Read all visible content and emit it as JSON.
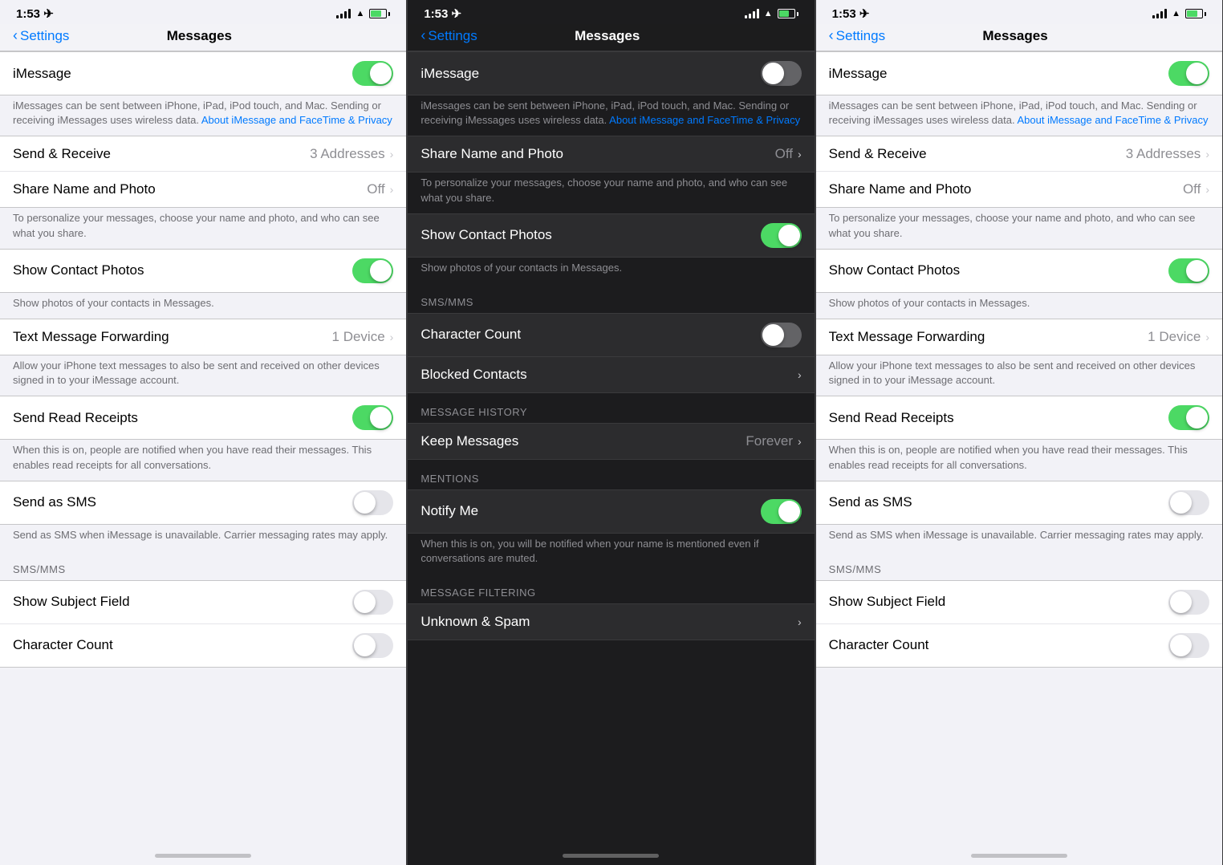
{
  "screens": [
    {
      "id": "screen-1",
      "theme": "light",
      "status": {
        "time": "1:53",
        "signal": true,
        "wifi": true,
        "battery_charge": true
      },
      "nav": {
        "back_label": "Settings",
        "title": "Messages"
      },
      "imessage": {
        "label": "iMessage",
        "state": "on"
      },
      "description1": "iMessages can be sent between iPhone, iPad, iPod touch, and Mac. Sending or receiving iMessages uses wireless data.",
      "link1": "About iMessage and FaceTime & Privacy",
      "rows": [
        {
          "label": "Send & Receive",
          "value": "3 Addresses",
          "has_chevron": true,
          "toggle": null
        },
        {
          "label": "Share Name and Photo",
          "value": "Off",
          "has_chevron": true,
          "toggle": null
        },
        {
          "description": "To personalize your messages, choose your name and photo, and who can see what you share."
        },
        {
          "label": "Show Contact Photos",
          "value": null,
          "has_chevron": false,
          "toggle": "on"
        },
        {
          "description": "Show photos of your contacts in Messages."
        },
        {
          "label": "Text Message Forwarding",
          "value": "1 Device",
          "has_chevron": true,
          "toggle": null
        },
        {
          "description": "Allow your iPhone text messages to also be sent and received on other devices signed in to your iMessage account."
        },
        {
          "label": "Send Read Receipts",
          "value": null,
          "has_chevron": false,
          "toggle": "on"
        },
        {
          "description": "When this is on, people are notified when you have read their messages. This enables read receipts for all conversations."
        },
        {
          "label": "Send as SMS",
          "value": null,
          "has_chevron": false,
          "toggle": "off"
        },
        {
          "description": "Send as SMS when iMessage is unavailable. Carrier messaging rates may apply."
        }
      ],
      "sms_section": "SMS/MMS",
      "sms_rows": [
        {
          "label": "Show Subject Field",
          "toggle": "off"
        },
        {
          "label": "Character Count",
          "toggle": "off"
        }
      ]
    },
    {
      "id": "screen-2",
      "theme": "dark",
      "status": {
        "time": "1:53",
        "signal": true,
        "wifi": true,
        "battery_charge": true
      },
      "nav": {
        "back_label": "Settings",
        "title": "Messages"
      },
      "imessage": {
        "label": "iMessage",
        "state": "off"
      },
      "description1": "iMessages can be sent between iPhone, iPad, iPod touch, and Mac. Sending or receiving iMessages uses wireless data.",
      "link1": "About iMessage and FaceTime & Privacy",
      "rows": [
        {
          "label": "Share Name and Photo",
          "value": "Off",
          "has_chevron": true,
          "toggle": null
        },
        {
          "description": "To personalize your messages, choose your name and photo, and who can see what you share."
        },
        {
          "label": "Show Contact Photos",
          "value": null,
          "has_chevron": false,
          "toggle": "on"
        },
        {
          "description": "Show photos of your contacts in Messages."
        }
      ],
      "sms_section": "SMS/MMS",
      "sms_rows": [
        {
          "label": "Character Count",
          "toggle": "off"
        },
        {
          "label": "Blocked Contacts",
          "value": null,
          "has_chevron": true
        }
      ],
      "message_history_section": "MESSAGE HISTORY",
      "message_history_rows": [
        {
          "label": "Keep Messages",
          "value": "Forever",
          "has_chevron": true
        }
      ],
      "mentions_section": "MENTIONS",
      "mentions_rows": [
        {
          "label": "Notify Me",
          "toggle": "on"
        },
        {
          "description": "When this is on, you will be notified when your name is mentioned even if conversations are muted."
        }
      ],
      "filtering_section": "MESSAGE FILTERING",
      "filtering_rows": [
        {
          "label": "Unknown & Spam",
          "has_chevron": true
        }
      ]
    },
    {
      "id": "screen-3",
      "theme": "light",
      "status": {
        "time": "1:53",
        "signal": true,
        "wifi": true,
        "battery_charge": true
      },
      "nav": {
        "back_label": "Settings",
        "title": "Messages"
      },
      "imessage": {
        "label": "iMessage",
        "state": "on"
      },
      "description1": "iMessages can be sent between iPhone, iPad, iPod touch, and Mac. Sending or receiving iMessages uses wireless data.",
      "link1": "About iMessage and FaceTime & Privacy",
      "rows": [
        {
          "label": "Send & Receive",
          "value": "3 Addresses",
          "has_chevron": true,
          "toggle": null
        },
        {
          "label": "Share Name and Photo",
          "value": "Off",
          "has_chevron": true,
          "toggle": null
        },
        {
          "description": "To personalize your messages, choose your name and photo, and who can see what you share."
        },
        {
          "label": "Show Contact Photos",
          "value": null,
          "has_chevron": false,
          "toggle": "on"
        },
        {
          "description": "Show photos of your contacts in Messages."
        },
        {
          "label": "Text Message Forwarding",
          "value": "1 Device",
          "has_chevron": true,
          "toggle": null
        },
        {
          "description": "Allow your iPhone text messages to also be sent and received on other devices signed in to your iMessage account."
        },
        {
          "label": "Send Read Receipts",
          "value": null,
          "has_chevron": false,
          "toggle": "on"
        },
        {
          "description": "When this is on, people are notified when you have read their messages. This enables read receipts for all conversations."
        },
        {
          "label": "Send as SMS",
          "value": null,
          "has_chevron": false,
          "toggle": "off"
        },
        {
          "description": "Send as SMS when iMessage is unavailable. Carrier messaging rates may apply."
        }
      ],
      "sms_section": "SMS/MMS",
      "sms_rows": [
        {
          "label": "Show Subject Field",
          "toggle": "off"
        },
        {
          "label": "Character Count",
          "toggle": "off"
        }
      ]
    }
  ]
}
